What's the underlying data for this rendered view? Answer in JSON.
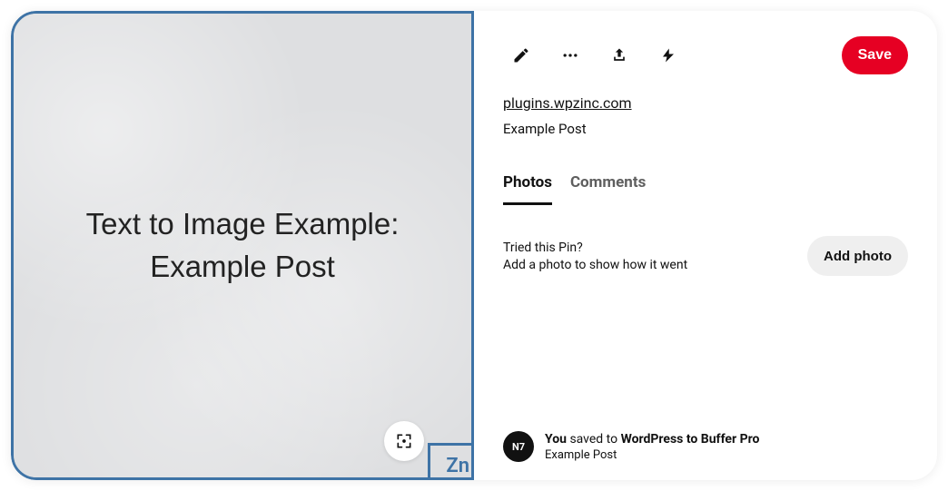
{
  "image": {
    "text_line1": "Text to Image Example:",
    "text_line2": "Example Post",
    "watermark": "Zn"
  },
  "toolbar": {
    "save_label": "Save"
  },
  "source": {
    "link_text": "plugins.wpzinc.com",
    "title": "Example Post"
  },
  "tabs": {
    "photos": "Photos",
    "comments": "Comments"
  },
  "tried": {
    "question": "Tried this Pin?",
    "subtext": "Add a photo to show how it went",
    "add_photo_label": "Add photo"
  },
  "attribution": {
    "avatar_text": "N7",
    "you": "You",
    "saved_to": " saved to ",
    "board": "WordPress to Buffer Pro",
    "subtitle": "Example Post"
  }
}
